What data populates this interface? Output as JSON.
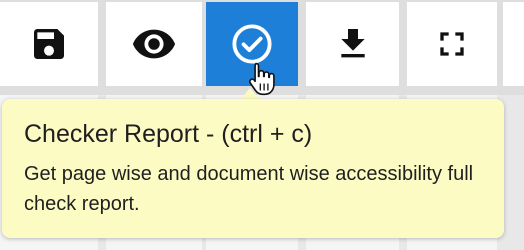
{
  "toolbar": {
    "accent_color": "#1e7fd9",
    "buttons": [
      {
        "id": "save",
        "icon": "save-icon",
        "active": false
      },
      {
        "id": "preview",
        "icon": "eye-icon",
        "active": false
      },
      {
        "id": "checker",
        "icon": "check-circle-icon",
        "active": true
      },
      {
        "id": "download",
        "icon": "download-icon",
        "active": false
      },
      {
        "id": "fullscreen",
        "icon": "fullscreen-icon",
        "active": false
      }
    ]
  },
  "tooltip": {
    "title": "Checker Report - (ctrl + c)",
    "description": "Get page wise and document wise accessibility full check report.",
    "background": "#fdfbc4"
  },
  "cursor": {
    "icon": "hand-pointer-icon"
  }
}
